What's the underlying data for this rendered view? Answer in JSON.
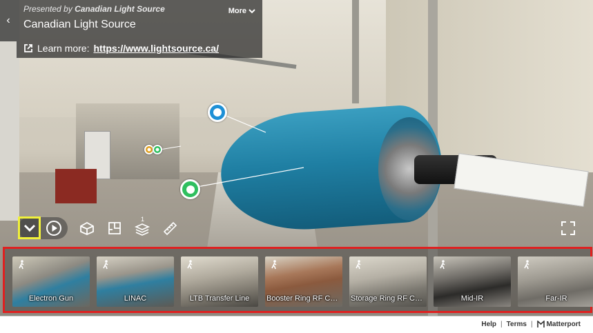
{
  "header": {
    "presented_prefix": "Presented by",
    "presenter": "Canadian Light Source",
    "title": "Canadian Light Source",
    "more_label": "More",
    "learn_more_label": "Learn more:",
    "learn_more_url": "https://www.lightsource.ca/"
  },
  "toolbar": {
    "icons": [
      "chevron-down-icon",
      "play-icon",
      "dollhouse-icon",
      "floorplan-icon",
      "floors-icon",
      "measure-icon",
      "fullscreen-icon"
    ],
    "floor_badge": "1"
  },
  "carousel": {
    "items": [
      {
        "label": "Electron Gun"
      },
      {
        "label": "LINAC"
      },
      {
        "label": "LTB Transfer Line"
      },
      {
        "label": "Booster Ring RF Cav..."
      },
      {
        "label": "Storage Ring RF Cav..."
      },
      {
        "label": "Mid-IR"
      },
      {
        "label": "Far-IR"
      }
    ]
  },
  "footer": {
    "help_label": "Help",
    "terms_label": "Terms",
    "brand_label": "Matterport"
  },
  "colors": {
    "highlight_yellow": "#f1f13a",
    "highlight_red": "#e02020",
    "hotspot_blue": "#1e90d6",
    "hotspot_green": "#2fbf5f",
    "hotspot_orange": "#e0a020"
  }
}
